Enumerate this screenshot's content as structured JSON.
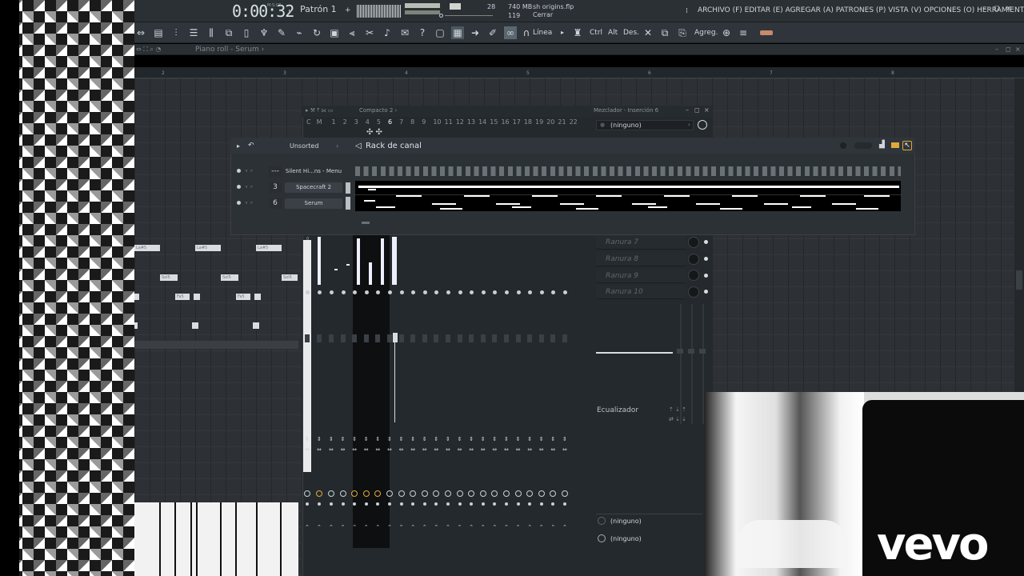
{
  "transport": {
    "time": "0:00:32",
    "time_unit": "M:S:CS",
    "pattern": "Patrón 1",
    "cpu": "28",
    "memory": "740 MB",
    "polyphony": "119"
  },
  "project": {
    "file": "sh origins.flp",
    "close": "Cerrar"
  },
  "menu": "ARCHIVO (F) EDITAR (E) AGREGAR (A) PATRONES (P) VISTA (V) OPCIONES (O) HERRAMIENTAS (T) AYUDA",
  "window_controls": [
    "–",
    "◻",
    "×"
  ],
  "toolbar": {
    "line_mode": "Línea",
    "ctrl": "Ctrl",
    "alt": "Alt",
    "des": "Des.",
    "agreg": "Agreg."
  },
  "piano_roll": {
    "title": "Piano roll - Serum ›",
    "bars": [
      "2",
      "3",
      "4",
      "5",
      "6",
      "7",
      "8"
    ],
    "notes": [
      {
        "label": "La#5"
      },
      {
        "label": "La#5"
      },
      {
        "label": "La#5"
      },
      {
        "label": "Sol5"
      },
      {
        "label": "Sol5"
      },
      {
        "label": "Sol5"
      },
      {
        "label": "Fa5"
      },
      {
        "label": "Fa5"
      }
    ]
  },
  "mixer": {
    "compact": "Compacto 2 ›",
    "title": "Mezclador - Inserción 6",
    "channel_labels": [
      "C",
      "M",
      "1",
      "2",
      "3",
      "4",
      "5",
      "6",
      "7",
      "8",
      "9",
      "10",
      "11",
      "12",
      "13",
      "14",
      "15",
      "16",
      "17",
      "18",
      "19",
      "20",
      "21",
      "22"
    ],
    "slot_top": "(ninguno)",
    "slots": [
      "Ranura 7",
      "Ranura 8",
      "Ranura 9",
      "Ranura 10"
    ],
    "eq_label": "Ecualizador",
    "output_1": "(ninguno)",
    "output_2": "(ninguno)"
  },
  "channel_rack": {
    "filter": "Unsorted",
    "title": "Rack de canal",
    "channels": [
      {
        "num": "---",
        "name": "Silent Hi...ns - Menu"
      },
      {
        "num": "3",
        "name": "Spacecraft 2"
      },
      {
        "num": "6",
        "name": "Serum"
      }
    ]
  },
  "video": {
    "logo": "vevo"
  }
}
